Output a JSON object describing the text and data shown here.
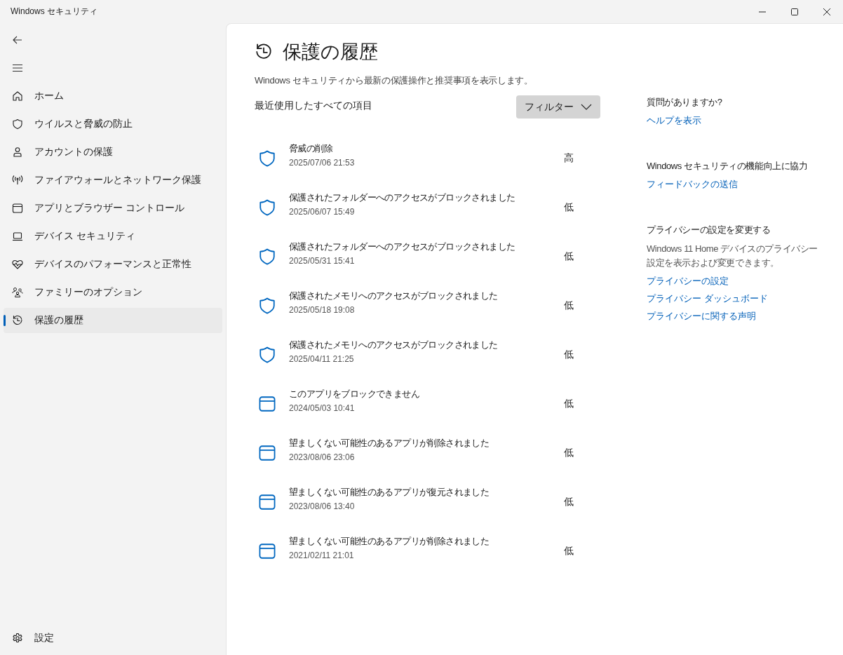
{
  "window": {
    "title": "Windows セキュリティ"
  },
  "sidebar": {
    "items": [
      {
        "label": "ホーム",
        "selected": false
      },
      {
        "label": "ウイルスと脅威の防止",
        "selected": false
      },
      {
        "label": "アカウントの保護",
        "selected": false
      },
      {
        "label": "ファイアウォールとネットワーク保護",
        "selected": false
      },
      {
        "label": "アプリとブラウザー コントロール",
        "selected": false
      },
      {
        "label": "デバイス セキュリティ",
        "selected": false
      },
      {
        "label": "デバイスのパフォーマンスと正常性",
        "selected": false
      },
      {
        "label": "ファミリーのオプション",
        "selected": false
      },
      {
        "label": "保護の履歴",
        "selected": true
      }
    ],
    "settings": "設定"
  },
  "page": {
    "title": "保護の履歴",
    "description": "Windows セキュリティから最新の保護操作と推奨事項を表示します。",
    "section_label": "最近使用したすべての項目",
    "filter_button": "フィルター"
  },
  "history": [
    {
      "kind": "shield",
      "title": "脅威の削除",
      "date": "2025/07/06 21:53",
      "severity": "高"
    },
    {
      "kind": "shield",
      "title": "保護されたフォルダーへのアクセスがブロックされました",
      "date": "2025/06/07 15:49",
      "severity": "低"
    },
    {
      "kind": "shield",
      "title": "保護されたフォルダーへのアクセスがブロックされました",
      "date": "2025/05/31 15:41",
      "severity": "低"
    },
    {
      "kind": "shield",
      "title": "保護されたメモリへのアクセスがブロックされました",
      "date": "2025/05/18 19:08",
      "severity": "低"
    },
    {
      "kind": "shield",
      "title": "保護されたメモリへのアクセスがブロックされました",
      "date": "2025/04/11 21:25",
      "severity": "低"
    },
    {
      "kind": "app",
      "title": "このアプリをブロックできません",
      "date": "2024/05/03 10:41",
      "severity": "低"
    },
    {
      "kind": "app",
      "title": "望ましくない可能性のあるアプリが削除されました",
      "date": "2023/08/06 23:06",
      "severity": "低"
    },
    {
      "kind": "app",
      "title": "望ましくない可能性のあるアプリが復元されました",
      "date": "2023/08/06 13:40",
      "severity": "低"
    },
    {
      "kind": "app",
      "title": "望ましくない可能性のあるアプリが削除されました",
      "date": "2021/02/11 21:01",
      "severity": "低"
    }
  ],
  "side_panel": [
    {
      "heading": "質問がありますか?",
      "links": [
        "ヘルプを表示"
      ]
    },
    {
      "heading": "Windows セキュリティの機能向上に協力",
      "links": [
        "フィードバックの送信"
      ]
    },
    {
      "heading": "プライバシーの設定を変更する",
      "text": "Windows 11 Home デバイスのプライバシー設定を表示および変更できます。",
      "links": [
        "プライバシーの設定",
        "プライバシー ダッシュボード",
        "プライバシーに関する声明"
      ]
    }
  ]
}
